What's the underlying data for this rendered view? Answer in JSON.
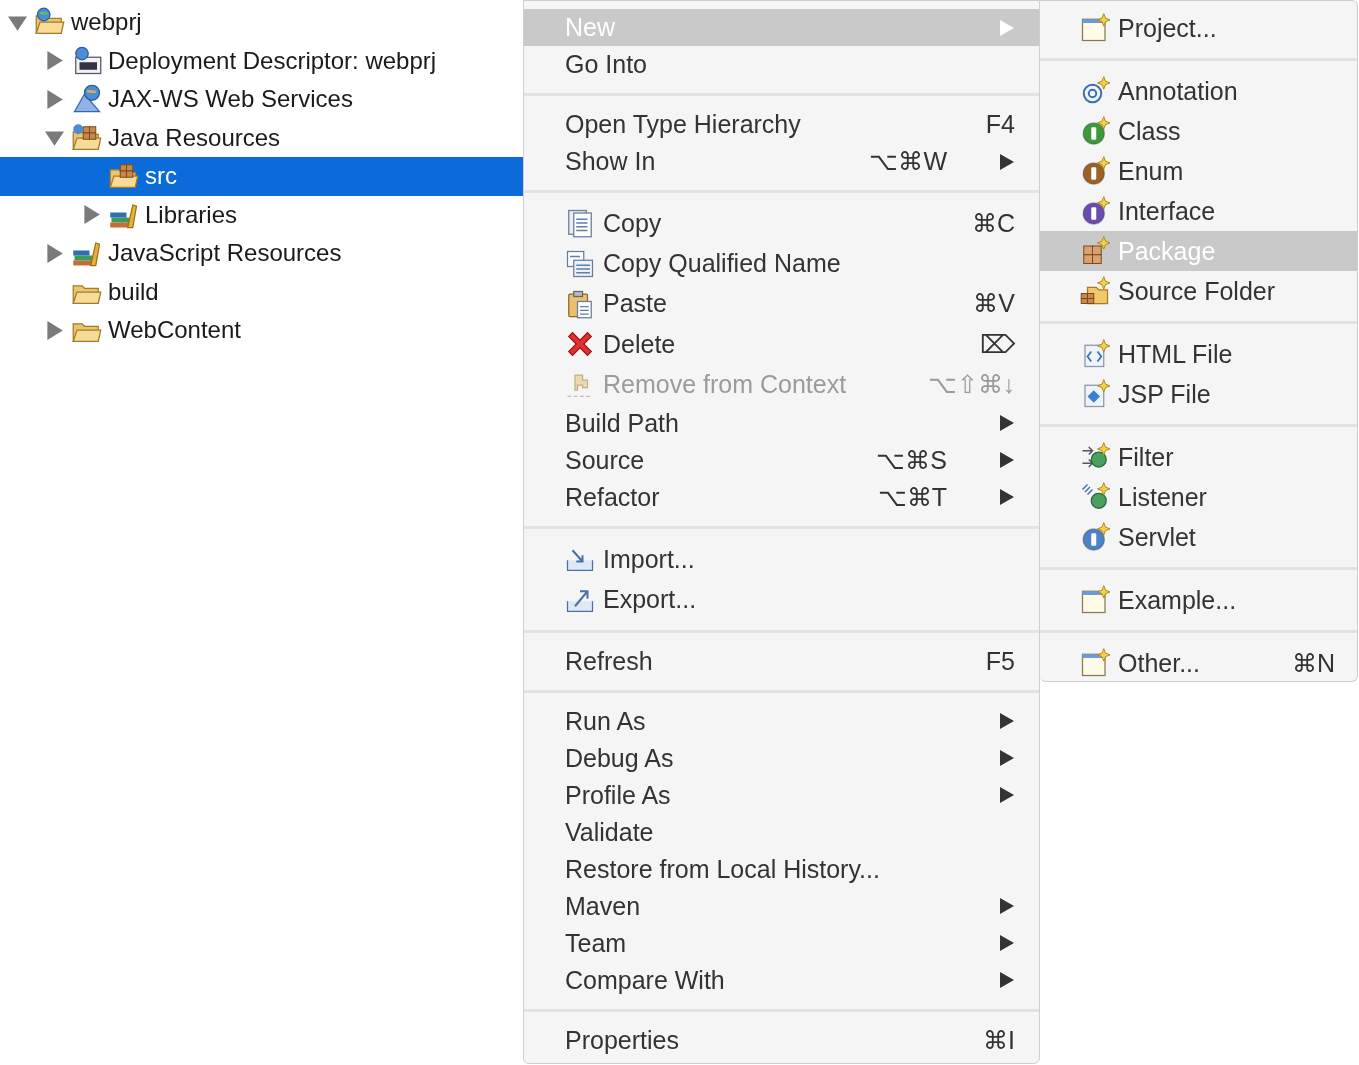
{
  "tree": [
    {
      "label": "webprj",
      "kind": "project",
      "expanded": true,
      "selected": false,
      "children": [
        {
          "label": "Deployment Descriptor: webprj",
          "kind": "descriptor",
          "expanded": false,
          "selected": false
        },
        {
          "label": "JAX-WS Web Services",
          "kind": "webservice",
          "expanded": false,
          "selected": false
        },
        {
          "label": "Java Resources",
          "kind": "java-resources",
          "expanded": true,
          "selected": false,
          "children": [
            {
              "label": "src",
              "kind": "package-folder",
              "selected": true
            },
            {
              "label": "Libraries",
              "kind": "libraries",
              "expanded": false,
              "selected": false
            }
          ]
        },
        {
          "label": "JavaScript Resources",
          "kind": "libraries",
          "expanded": false,
          "selected": false
        },
        {
          "label": "build",
          "kind": "folder",
          "selected": false
        },
        {
          "label": "WebContent",
          "kind": "folder",
          "expanded": false,
          "selected": false
        }
      ]
    }
  ],
  "context_menu": {
    "sections": [
      [
        {
          "label": "New",
          "kind": "plain",
          "submenu": true,
          "disabled": false,
          "selected": true
        },
        {
          "label": "Go Into",
          "kind": "plain",
          "submenu": false,
          "disabled": false,
          "selected": false
        }
      ],
      [
        {
          "label": "Open Type Hierarchy",
          "kind": "plain",
          "shortcut": "F4",
          "submenu": false,
          "disabled": false,
          "selected": false
        },
        {
          "label": "Show In",
          "kind": "plain",
          "shortcut": "⌥⌘W",
          "submenu": true,
          "disabled": false,
          "selected": false
        }
      ],
      [
        {
          "label": "Copy",
          "kind": "copy",
          "shortcut": "⌘C",
          "submenu": false,
          "disabled": false,
          "selected": false
        },
        {
          "label": "Copy Qualified Name",
          "kind": "copy-qualified",
          "submenu": false,
          "disabled": false,
          "selected": false
        },
        {
          "label": "Paste",
          "kind": "paste",
          "shortcut": "⌘V",
          "submenu": false,
          "disabled": false,
          "selected": false
        },
        {
          "label": "Delete",
          "kind": "delete",
          "shortcut": "⌦",
          "submenu": false,
          "disabled": false,
          "selected": false
        },
        {
          "label": "Remove from Context",
          "kind": "remove",
          "shortcut": "⌥⇧⌘↓",
          "submenu": false,
          "disabled": true,
          "selected": false
        },
        {
          "label": "Build Path",
          "kind": "plain",
          "submenu": true,
          "disabled": false,
          "selected": false
        },
        {
          "label": "Source",
          "kind": "plain",
          "shortcut": "⌥⌘S",
          "submenu": true,
          "disabled": false,
          "selected": false
        },
        {
          "label": "Refactor",
          "kind": "plain",
          "shortcut": "⌥⌘T",
          "submenu": true,
          "disabled": false,
          "selected": false
        }
      ],
      [
        {
          "label": "Import...",
          "kind": "import",
          "submenu": false,
          "disabled": false,
          "selected": false
        },
        {
          "label": "Export...",
          "kind": "export",
          "submenu": false,
          "disabled": false,
          "selected": false
        }
      ],
      [
        {
          "label": "Refresh",
          "kind": "plain",
          "shortcut": "F5",
          "submenu": false,
          "disabled": false,
          "selected": false
        }
      ],
      [
        {
          "label": "Run As",
          "kind": "plain",
          "submenu": true,
          "disabled": false,
          "selected": false
        },
        {
          "label": "Debug As",
          "kind": "plain",
          "submenu": true,
          "disabled": false,
          "selected": false
        },
        {
          "label": "Profile As",
          "kind": "plain",
          "submenu": true,
          "disabled": false,
          "selected": false
        },
        {
          "label": "Validate",
          "kind": "plain",
          "submenu": false,
          "disabled": false,
          "selected": false
        },
        {
          "label": "Restore from Local History...",
          "kind": "plain",
          "submenu": false,
          "disabled": false,
          "selected": false
        },
        {
          "label": "Maven",
          "kind": "plain",
          "submenu": true,
          "disabled": false,
          "selected": false
        },
        {
          "label": "Team",
          "kind": "plain",
          "submenu": true,
          "disabled": false,
          "selected": false
        },
        {
          "label": "Compare With",
          "kind": "plain",
          "submenu": true,
          "disabled": false,
          "selected": false
        }
      ],
      [
        {
          "label": "Properties",
          "kind": "plain",
          "shortcut": "⌘I",
          "submenu": false,
          "disabled": false,
          "selected": false
        }
      ]
    ]
  },
  "new_submenu": {
    "sections": [
      [
        {
          "label": "Project...",
          "kind": "wizard",
          "selected": false
        }
      ],
      [
        {
          "label": "Annotation",
          "kind": "annotation",
          "selected": false
        },
        {
          "label": "Class",
          "kind": "class",
          "selected": false
        },
        {
          "label": "Enum",
          "kind": "enum",
          "selected": false
        },
        {
          "label": "Interface",
          "kind": "interface",
          "selected": false
        },
        {
          "label": "Package",
          "kind": "package",
          "selected": true
        },
        {
          "label": "Source Folder",
          "kind": "source-folder",
          "selected": false
        }
      ],
      [
        {
          "label": "HTML File",
          "kind": "html",
          "selected": false
        },
        {
          "label": "JSP File",
          "kind": "jsp",
          "selected": false
        }
      ],
      [
        {
          "label": "Filter",
          "kind": "filter",
          "selected": false
        },
        {
          "label": "Listener",
          "kind": "listener",
          "selected": false
        },
        {
          "label": "Servlet",
          "kind": "servlet",
          "selected": false
        }
      ],
      [
        {
          "label": "Example...",
          "kind": "wizard",
          "selected": false
        }
      ],
      [
        {
          "label": "Other...",
          "kind": "wizard",
          "shortcut": "⌘N",
          "selected": false
        }
      ]
    ]
  }
}
